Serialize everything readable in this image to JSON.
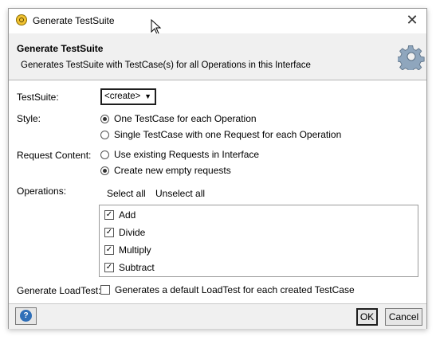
{
  "window": {
    "title": "Generate TestSuite",
    "close_glyph": "✕"
  },
  "header": {
    "title": "Generate TestSuite",
    "description": "Generates TestSuite with TestCase(s) for all Operations in this Interface",
    "icon": "gear-icon"
  },
  "form": {
    "testsuite_label": "TestSuite:",
    "testsuite_value": "<create>",
    "style_label": "Style:",
    "style_options": [
      {
        "label": "One TestCase for each Operation",
        "selected": true
      },
      {
        "label": "Single TestCase with one Request for each Operation",
        "selected": false
      }
    ],
    "request_label": "Request Content:",
    "request_options": [
      {
        "label": "Use existing Requests in Interface",
        "selected": false
      },
      {
        "label": "Create new empty requests",
        "selected": true
      }
    ],
    "operations_label": "Operations:",
    "select_all": "Select all",
    "unselect_all": "Unselect all",
    "operations": [
      {
        "label": "Add",
        "checked": true
      },
      {
        "label": "Divide",
        "checked": true
      },
      {
        "label": "Multiply",
        "checked": true
      },
      {
        "label": "Subtract",
        "checked": true
      }
    ],
    "loadtest_label": "Generate LoadTest:",
    "loadtest_option": "Generates a default LoadTest for each created TestCase",
    "loadtest_checked": false
  },
  "footer": {
    "help": "?",
    "ok": "OK",
    "cancel": "Cancel"
  },
  "colors": {
    "header_bg": "#f0f0f0",
    "footer_bg": "#f0f0f0",
    "help_blue": "#2f6fb8"
  }
}
